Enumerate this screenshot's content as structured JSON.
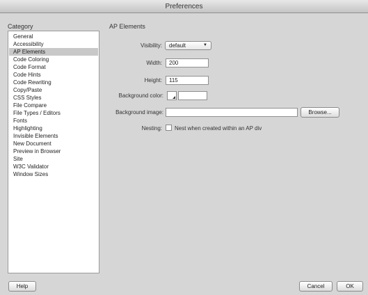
{
  "window": {
    "title": "Preferences"
  },
  "category_label": "Category",
  "categories": [
    {
      "label": "General"
    },
    {
      "label": "Accessibility"
    },
    {
      "label": "AP Elements"
    },
    {
      "label": "Code Coloring"
    },
    {
      "label": "Code Format"
    },
    {
      "label": "Code Hints"
    },
    {
      "label": "Code Rewriting"
    },
    {
      "label": "Copy/Paste"
    },
    {
      "label": "CSS Styles"
    },
    {
      "label": "File Compare"
    },
    {
      "label": "File Types / Editors"
    },
    {
      "label": "Fonts"
    },
    {
      "label": "Highlighting"
    },
    {
      "label": "Invisible Elements"
    },
    {
      "label": "New Document"
    },
    {
      "label": "Preview in Browser"
    },
    {
      "label": "Site"
    },
    {
      "label": "W3C Validator"
    },
    {
      "label": "Window Sizes"
    }
  ],
  "selected_category": "AP Elements",
  "panel": {
    "title": "AP Elements",
    "visibility_label": "Visibility:",
    "visibility_value": "default",
    "width_label": "Width:",
    "width_value": "200",
    "height_label": "Height:",
    "height_value": "115",
    "bg_color_label": "Background color:",
    "bg_color_value": "",
    "bg_image_label": "Background image:",
    "bg_image_value": "",
    "browse_label": "Browse...",
    "nesting_label": "Nesting:",
    "nesting_checkbox_label": "Nest when created within an AP div",
    "nesting_checked": false
  },
  "buttons": {
    "help": "Help",
    "cancel": "Cancel",
    "ok": "OK"
  },
  "icons": {
    "select_arrow": "chevron-down-icon",
    "color_swatch": "color-picker-icon"
  }
}
